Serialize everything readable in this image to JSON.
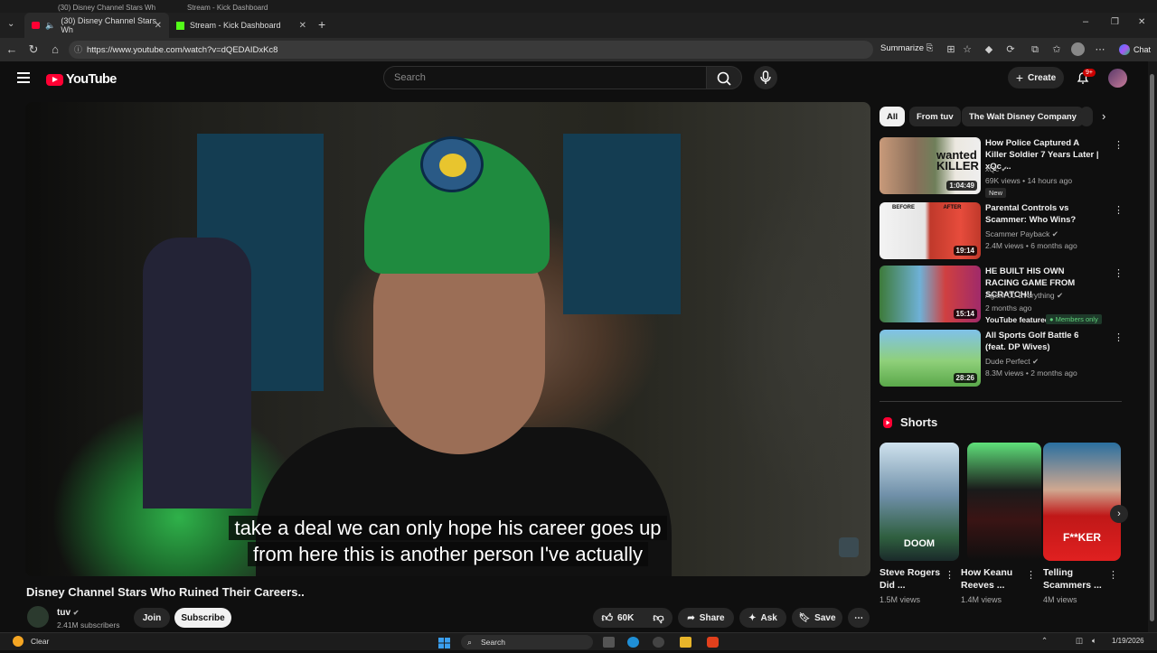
{
  "browser": {
    "tabs": [
      {
        "title": "(30) Disney Channel Stars Wh",
        "active": true
      },
      {
        "title": "Stream - Kick Dashboard",
        "active": false
      }
    ],
    "ghost_tabs": [
      "(30) Disney Channel Stars Wh",
      "Stream - Kick Dashboard"
    ],
    "url": "https://www.youtube.com/watch?v=dQEDAIDxKc8",
    "summarize_label": "Summarize",
    "chat_label": "Chat"
  },
  "youtube": {
    "logo_text": "YouTube",
    "search_placeholder": "Search",
    "create_label": "Create",
    "notif_count": "9+"
  },
  "video": {
    "caption_line1": "take a deal we can only hope his career goes up",
    "caption_line2": "from here this is another person I've actually",
    "title": "Disney Channel Stars Who Ruined Their Careers..",
    "channel": "tuv",
    "subscribers": "2.41M subscribers",
    "join_label": "Join",
    "subscribe_label": "Subscribe",
    "likes": "60K",
    "share_label": "Share",
    "ask_label": "Ask",
    "save_label": "Save"
  },
  "chips": [
    "All",
    "From tuv",
    "The Walt Disney Company"
  ],
  "recommendations": [
    {
      "title": "How Police Captured A Killer Soldier 7 Years Later | xQc ...",
      "channel": "xQc",
      "meta": "69K views • 14 hours ago",
      "duration": "1:04:49",
      "badge": "New",
      "thumb_text": "wanted KILLER"
    },
    {
      "title": "Parental Controls vs Scammer: Who Wins?",
      "channel": "Scammer Payback",
      "meta": "2.4M views • 6 months ago",
      "duration": "19:14",
      "thumb_text": "BEFORE AFTER"
    },
    {
      "title": "HE BUILT HIS OWN RACING GAME FROM SCRATCH!!",
      "channel": "Agent 00 Everything",
      "meta": "2 months ago",
      "duration": "15:14",
      "featured": "YouTube featured",
      "members": "Members only"
    },
    {
      "title": "All Sports Golf Battle 6 (feat. DP Wives)",
      "channel": "Dude Perfect",
      "meta": "8.3M views • 2 months ago",
      "duration": "28:26"
    }
  ],
  "shorts": {
    "header": "Shorts",
    "items": [
      {
        "title": "Steve Rogers Did ...",
        "views": "1.5M views",
        "thumb_text": "DOOM"
      },
      {
        "title": "How Keanu Reeves ...",
        "views": "1.4M views"
      },
      {
        "title": "Telling Scammers ...",
        "views": "4M views",
        "thumb_text": "F**KER"
      }
    ]
  },
  "taskbar": {
    "weather": "Clear",
    "search_label": "Search",
    "date": "1/19/2026"
  }
}
